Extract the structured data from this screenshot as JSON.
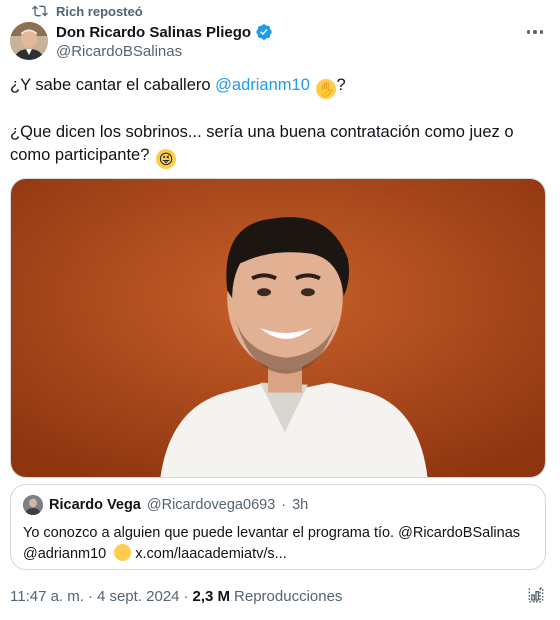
{
  "repost": {
    "label": "Rich reposteó",
    "icon": "repost-icon"
  },
  "author": {
    "display_name": "Don Ricardo Salinas Pliego",
    "handle": "@RicardoBSalinas",
    "verified": true,
    "verified_color": "#1d9bf0"
  },
  "tweet": {
    "line1_prefix": "¿Y sabe cantar el caballero ",
    "line1_mention": "@adrianm10",
    "line1_suffix": "?",
    "line1_emoji": "thinking-face",
    "line2": "¿Que dicen los sobrinos... sería una buena contratación como juez o como participante?",
    "line2_emoji": "zany-face"
  },
  "quote": {
    "name": "Ricardo Vega",
    "handle": "@Ricardovega0693",
    "separator": "·",
    "time": "3h",
    "text_prefix": "Yo conozco a alguien que puede levantar el programa tío.  ",
    "mention1": "@RicardoBSalinas",
    "mention2": "@adrianm10",
    "emoji": "face-peeking",
    "link": "x.com/laacademiatv/s..."
  },
  "meta": {
    "time": "11:47 a. m.",
    "separator1": "·",
    "date": "4 sept. 2024",
    "separator2": "·",
    "views_count": "2,3 M",
    "views_label": "Reproducciones"
  },
  "colors": {
    "accent": "#1d9bf0",
    "text": "#0f1419",
    "secondary": "#536471",
    "border": "#cfd9de",
    "photo_background": "#b84d1c"
  }
}
